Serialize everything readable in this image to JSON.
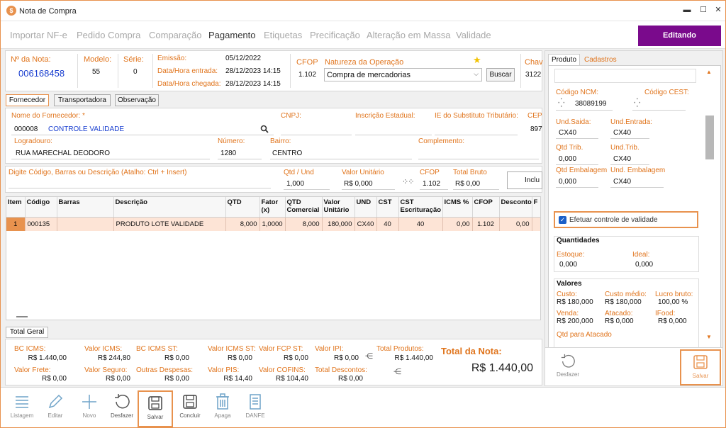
{
  "window": {
    "title": "Nota de Compra",
    "minimize": "▬",
    "maximize": "☐",
    "close": "✕"
  },
  "nav_tabs": [
    "Importar NF-e",
    "Pedido Compra",
    "Comparação",
    "Pagamento",
    "Etiquetas",
    "Precificação",
    "Alteração em Massa",
    "Validade"
  ],
  "status_label": "Editando",
  "header": {
    "nota_label": "Nº da Nota:",
    "nota_value": "006168458",
    "modelo_label": "Modelo:",
    "modelo_value": "55",
    "serie_label": "Série:",
    "serie_value": "0",
    "emissao_label": "Emissão:",
    "emissao_value": "05/12/2022",
    "entrada_label": "Data/Hora entrada:",
    "entrada_value": "28/12/2023 14:15",
    "chegada_label": "Data/Hora chegada:",
    "chegada_value": "28/12/2023 14:15",
    "cfop_label": "CFOP",
    "cfop_value": "1.102",
    "natureza_label": "Natureza da Operação",
    "natureza_value": "Compra de mercadorias",
    "buscar_label": "Buscar",
    "chave_label": "Chav",
    "chave_value": "3122"
  },
  "sub_tabs": [
    "Fornecedor",
    "Transportadora",
    "Observação"
  ],
  "fornecedor": {
    "nome_label": "Nome do Fornecedor: *",
    "codigo": "000008",
    "nome": "CONTROLE VALIDADE",
    "cnpj_label": "CNPJ:",
    "ie_label": "Inscrição Estadual:",
    "iest_label": "IE do Substituto Tributário:",
    "cep_label": "CEP",
    "cep_value": "897",
    "logradouro_label": "Logradouro:",
    "logradouro_value": "RUA MARECHAL DEODORO",
    "numero_label": "Número:",
    "numero_value": "1280",
    "bairro_label": "Bairro:",
    "bairro_value": "CENTRO",
    "complemento_label": "Complemento:"
  },
  "item_entry": {
    "search_label": "Digite Código, Barras ou Descrição (Atalho: Ctrl + Insert)",
    "qtd_label": "Qtd / Und",
    "qtd_value": "1,000",
    "valor_label": "Valor Unitário",
    "valor_value": "R$ 0,000",
    "cfop_label": "CFOP",
    "cfop_value": "1.102",
    "total_label": "Total Bruto",
    "total_value": "R$ 0,00",
    "incluir_label": "Inclu"
  },
  "grid": {
    "headers": [
      "Item",
      "Código",
      "Barras",
      "Descrição",
      "QTD",
      "Fator (x)",
      "QTD Comercial",
      "Valor Unitário",
      "UND",
      "CST",
      "CST Escrituração",
      "ICMS %",
      "CFOP",
      "Desconto",
      "F"
    ],
    "rows": [
      [
        "1",
        "000135",
        "",
        "PRODUTO LOTE VALIDADE",
        "8,000",
        "1,0000",
        "8,000",
        "180,000",
        "CX40",
        "40",
        "40",
        "0,00",
        "1.102",
        "0,00",
        ""
      ]
    ]
  },
  "total_geral_tab": "Total Geral",
  "totals": {
    "bc_icms_label": "BC ICMS:",
    "bc_icms": "R$ 1.440,00",
    "valor_icms_label": "Valor ICMS:",
    "valor_icms": "R$ 244,80",
    "bc_icms_st_label": "BC ICMS ST:",
    "bc_icms_st": "R$ 0,00",
    "valor_icms_st_label": "Valor ICMS ST:",
    "valor_icms_st": "R$ 0,00",
    "valor_fcp_st_label": "Valor FCP ST:",
    "valor_fcp_st": "R$ 0,00",
    "valor_ipi_label": "Valor IPI:",
    "valor_ipi": "R$ 0,00",
    "total_produtos_label": "Total Produtos:",
    "total_produtos": "R$ 1.440,00",
    "valor_frete_label": "Valor Frete:",
    "valor_frete": "R$ 0,00",
    "valor_seguro_label": "Valor Seguro:",
    "valor_seguro": "R$ 0,00",
    "outras_despesas_label": "Outras Despesas:",
    "outras_despesas": "R$ 0,00",
    "valor_pis_label": "Valor PIS:",
    "valor_pis": "R$ 14,40",
    "valor_cofins_label": "Valor COFINS:",
    "valor_cofins": "R$ 104,40",
    "total_descontos_label": "Total Descontos:",
    "total_descontos": "R$ 0,00",
    "total_nota_label": "Total da Nota:",
    "total_nota": "R$ 1.440,00"
  },
  "right_panel": {
    "tabs": [
      "Produto",
      "Cadastros"
    ],
    "ncm_label": "Código NCM:",
    "ncm_value": "38089199",
    "cest_label": "Código CEST:",
    "und_saida_label": "Und.Saida:",
    "und_saida": "CX40",
    "und_entrada_label": "Und.Entrada:",
    "und_entrada": "CX40",
    "qtd_trib_label": "Qtd Trib.",
    "qtd_trib": "0,000",
    "und_trib_label": "Und.Trib.",
    "und_trib": "CX40",
    "qtd_emb_label": "Qtd Embalagem",
    "qtd_emb": "0,000",
    "und_emb_label": "Und. Embalagem",
    "und_emb": "CX40",
    "validade_label": "Efetuar controle de validade",
    "quantidades_title": "Quantidades",
    "estoque_label": "Estoque:",
    "estoque": "0,000",
    "ideal_label": "Ideal:",
    "ideal": "0,000",
    "valores_title": "Valores",
    "custo_label": "Custo:",
    "custo": "R$ 180,000",
    "custo_medio_label": "Custo médio:",
    "custo_medio": "R$ 180,000",
    "lucro_label": "Lucro bruto:",
    "lucro": "100,00 %",
    "venda_label": "Venda:",
    "venda": "R$ 200,000",
    "atacado_label": "Atacado:",
    "atacado": "R$ 0,000",
    "ifood_label": "IFood:",
    "ifood": "R$ 0,000",
    "qtd_atacado_label": "Qtd para Atacado",
    "desfazer": "Desfazer",
    "salvar": "Salvar"
  },
  "toolbar": {
    "listagem": "Listagem",
    "editar": "Editar",
    "novo": "Novo",
    "desfazer": "Desfazer",
    "salvar": "Salvar",
    "concluir": "Concluir",
    "apaga": "Apaga",
    "danfe": "DANFE"
  },
  "colors": {
    "accent": "#e8924e",
    "brand": "#7a0a8c",
    "link": "#1a3fd0",
    "highlight_row": "#fde4d6"
  }
}
